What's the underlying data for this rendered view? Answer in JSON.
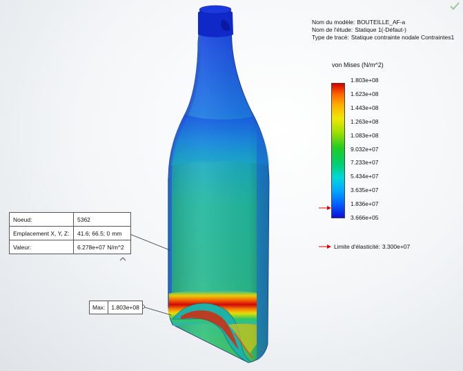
{
  "model_info": {
    "model_label": "Nom du modèle:",
    "model_value": "BOUTEILLE_AF-a",
    "study_label": "Nom de l'étude:",
    "study_value": "Statique 1(-Défaut-)",
    "plot_label": "Type de tracé:",
    "plot_value": "Statique contrainte nodale Contraintes1"
  },
  "legend": {
    "title": "von Mises (N/m^2)",
    "ticks": [
      "1.803e+08",
      "1.623e+08",
      "1.443e+08",
      "1.263e+08",
      "1.083e+08",
      "9.032e+07",
      "7.233e+07",
      "5.434e+07",
      "3.635e+07",
      "1.836e+07",
      "3.666e+05"
    ],
    "yield_label": "Limite d'élasticité:",
    "yield_value": "3.300e+07",
    "marker_color": "#e00000"
  },
  "probe": {
    "node_label": "Noeud:",
    "node_value": "5362",
    "location_label": "Emplacement X, Y, Z:",
    "location_value": "41.6; 66.5; 0",
    "location_unit": "mm",
    "value_label": "Valeur:",
    "value_value": "6.278e+07",
    "value_unit": "N/m^2"
  },
  "max_marker": {
    "label": "Max:",
    "value": "1.803e+08"
  },
  "icons": {
    "confirm": "check-icon",
    "collapse": "chevron-up-icon"
  },
  "colors": {
    "accent_check": "#4caf50",
    "stress_high": "#d40000",
    "stress_low": "#0a10d8"
  }
}
